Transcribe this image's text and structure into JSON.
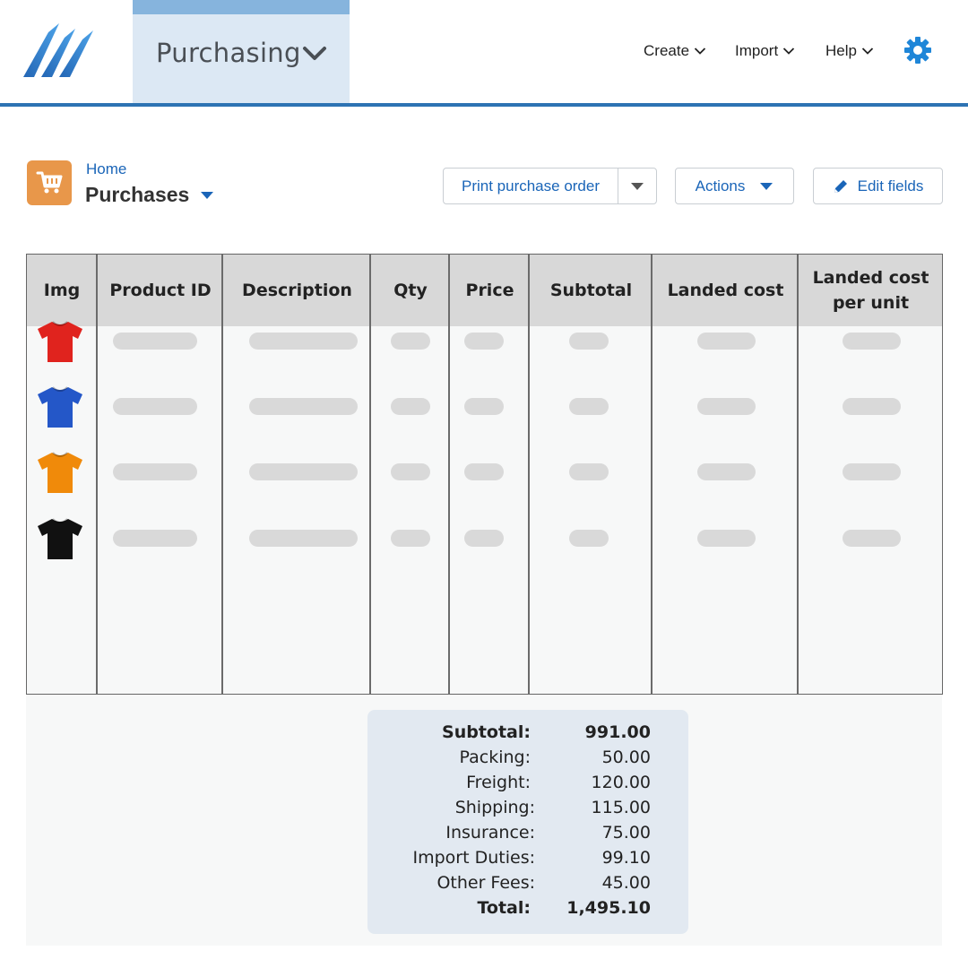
{
  "topnav": {
    "app_name": "Purchasing",
    "create_label": "Create",
    "import_label": "Import",
    "help_label": "Help",
    "accent_color": "#2d73b3"
  },
  "page": {
    "breadcrumb": "Home",
    "title": "Purchases",
    "icon": "shopping-cart-icon"
  },
  "actions": {
    "print_label": "Print purchase order",
    "actions_label": "Actions",
    "edit_label": "Edit fields"
  },
  "table": {
    "columns": [
      "Img",
      "Product ID",
      "Description",
      "Qty",
      "Price",
      "Subtotal",
      "Landed cost",
      "Landed cost per unit"
    ],
    "rows": [
      {
        "image": "red-tshirt",
        "color": "#e0231e"
      },
      {
        "image": "blue-tshirt",
        "color": "#2457c8"
      },
      {
        "image": "orange-tshirt",
        "color": "#f08a0a"
      },
      {
        "image": "black-tshirt",
        "color": "#111111"
      }
    ]
  },
  "totals": [
    {
      "label": "Subtotal:",
      "value": "991.00",
      "bold": true
    },
    {
      "label": "Packing:",
      "value": "50.00",
      "bold": false
    },
    {
      "label": "Freight:",
      "value": "120.00",
      "bold": false
    },
    {
      "label": "Shipping:",
      "value": "115.00",
      "bold": false
    },
    {
      "label": "Insurance:",
      "value": "75.00",
      "bold": false
    },
    {
      "label": "Import Duties:",
      "value": "99.10",
      "bold": false
    },
    {
      "label": "Other Fees:",
      "value": "45.00",
      "bold": false
    },
    {
      "label": "Total:",
      "value": "1,495.10",
      "bold": true
    }
  ]
}
